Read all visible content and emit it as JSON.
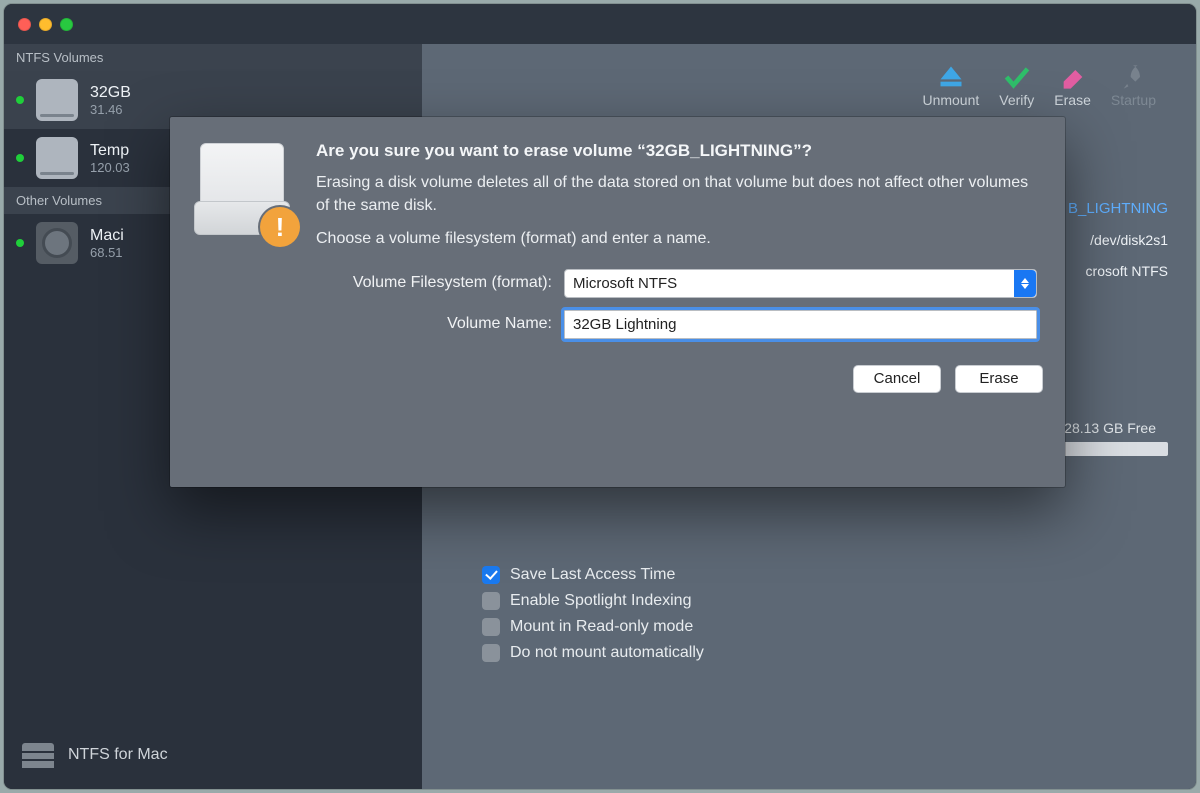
{
  "toolbar": {
    "unmount": "Unmount",
    "verify": "Verify",
    "erase": "Erase",
    "startup": "Startup"
  },
  "sidebar": {
    "section1": "NTFS Volumes",
    "section2": "Other Volumes",
    "items": [
      {
        "name": "32GB",
        "sub": "31.46"
      },
      {
        "name": "Temp",
        "sub": "120.03"
      },
      {
        "name": "Maci",
        "sub": "68.51"
      }
    ],
    "footer": "NTFS for Mac"
  },
  "info": {
    "name": "B_LIGHTNING",
    "device": "/dev/disk2s1",
    "fs": "crosoft NTFS",
    "free": "28.13 GB Free"
  },
  "options": {
    "opt1": "Save Last Access Time",
    "opt2": "Enable Spotlight Indexing",
    "opt3": "Mount in Read-only mode",
    "opt4": "Do not mount automatically"
  },
  "modal": {
    "title": "Are you sure you want to erase volume “32GB_LIGHTNING”?",
    "desc": "Erasing a disk volume deletes all of the data stored on that volume but does not affect other volumes of the same disk.",
    "choose": "Choose a volume filesystem (format) and enter a name.",
    "fs_label": "Volume Filesystem (format):",
    "fs_value": "Microsoft NTFS",
    "name_label": "Volume Name:",
    "name_value": "32GB Lightning",
    "cancel": "Cancel",
    "erase": "Erase",
    "badge": "!"
  }
}
